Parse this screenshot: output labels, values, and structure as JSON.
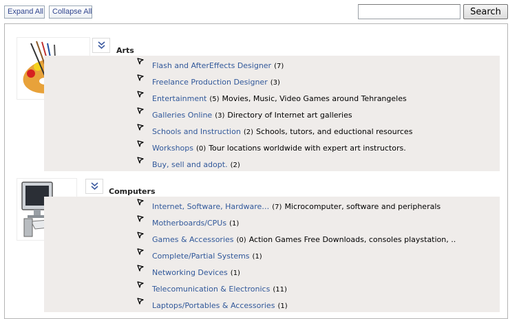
{
  "toolbar": {
    "expand_all": "Expand All",
    "collapse_all": "Collapse All",
    "search_placeholder": "",
    "search_button": "Search"
  },
  "categories": [
    {
      "title": "Arts",
      "icon": "art-palette-icon",
      "items": [
        {
          "label": "Flash and AfterEffects Designer",
          "count": "(7)",
          "description": ""
        },
        {
          "label": "Freelance Production Designer",
          "count": "(3)",
          "description": ""
        },
        {
          "label": "Entertainment",
          "count": "(5)",
          "description": "Movies, Music, Video Games around Tehrangeles"
        },
        {
          "label": "Galleries Online",
          "count": "(3)",
          "description": "Directory of Internet art galleries"
        },
        {
          "label": "Schools and Instruction",
          "count": "(2)",
          "description": "Schools, tutors, and eductional resources"
        },
        {
          "label": "Workshops",
          "count": "(0)",
          "description": "Tour locations worldwide with expert art instructors."
        },
        {
          "label": "Buy, sell and adopt.",
          "count": "(2)",
          "description": ""
        }
      ]
    },
    {
      "title": "Computers",
      "icon": "computer-icon",
      "items": [
        {
          "label": "Internet, Software, Hardware…",
          "count": "(7)",
          "description": "Microcomputer, software and peripherals"
        },
        {
          "label": "Motherboards/CPUs",
          "count": "(1)",
          "description": ""
        },
        {
          "label": "Games & Accessories",
          "count": "(0)",
          "description": "Action Games Free Downloads, consoles playstation, .."
        },
        {
          "label": "Complete/Partial Systems",
          "count": "(1)",
          "description": ""
        },
        {
          "label": "Networking Devices",
          "count": "(1)",
          "description": ""
        },
        {
          "label": "Telecomunication & Electronics",
          "count": "(11)",
          "description": ""
        },
        {
          "label": "Laptops/Portables & Accessories",
          "count": "(1)",
          "description": ""
        }
      ]
    }
  ]
}
